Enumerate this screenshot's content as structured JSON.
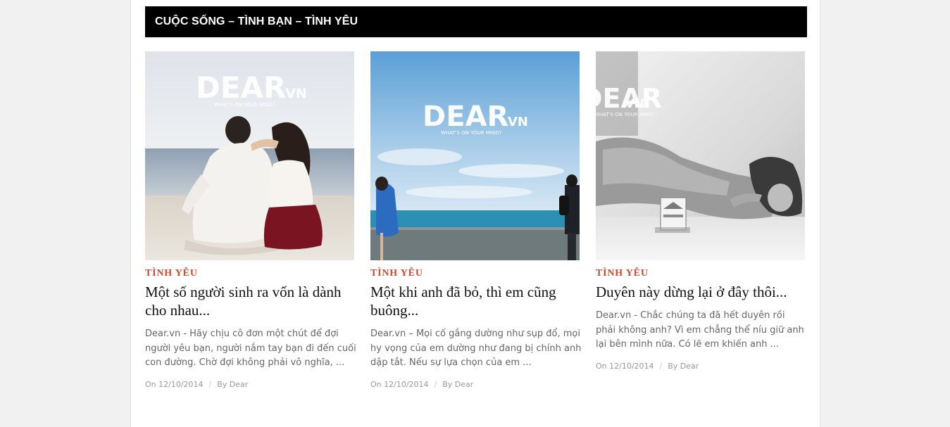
{
  "section": {
    "title": "CUỘC SỐNG – TÌNH BẠN – TÌNH YÊU"
  },
  "watermark": {
    "brand": "DEAR",
    "tld": ".VN",
    "tagline": "WHAT'S ON YOUR MIND?"
  },
  "posts": [
    {
      "category": "TÌNH YÊU",
      "title": "Một số người sinh ra vốn là dành cho nhau...",
      "excerpt": "Dear.vn - Hãy chịu cô đơn một chút để đợi người yêu bạn, người nắm tay bạn đi đến cuối con đường. Chờ đợi không phải vô nghĩa, ...",
      "date": "On 12/10/2014",
      "separator": "/",
      "author": "By Dear",
      "image_icon": "couple-beach-photo"
    },
    {
      "category": "TÌNH YÊU",
      "title": "Một khi anh đã bỏ, thì em cũng buông...",
      "excerpt": "Dear.vn – Mọi cố gắng dường như sụp đổ, mọi hy vọng của em dường như đang bị chính anh dập tắt. Nếu sự lựa chọn của em ...",
      "date": "On 12/10/2014",
      "separator": "/",
      "author": "By Dear",
      "image_icon": "sea-sky-photo"
    },
    {
      "category": "TÌNH YÊU",
      "title": "Duyên này dừng lại ở đây thôi...",
      "excerpt": "Dear.vn - Chắc chúng ta đã hết duyên rồi phải không anh? Vì em chẳng thể níu giữ anh lại bên mình nữa. Có lẽ em khiến anh ...",
      "date": "On 12/10/2014",
      "separator": "/",
      "author": "By Dear",
      "image_icon": "woman-bed-photo"
    }
  ]
}
